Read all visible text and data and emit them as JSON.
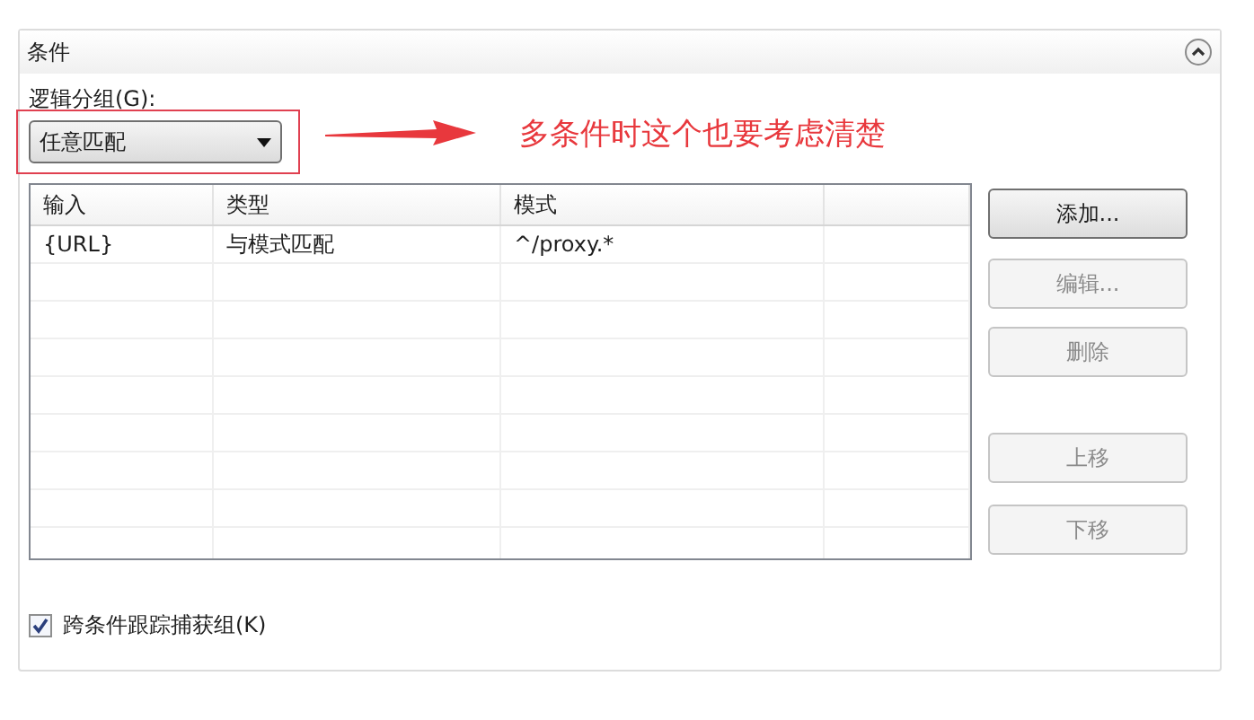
{
  "panel": {
    "title": "条件",
    "expanded": true
  },
  "logic_group": {
    "label": "逻辑分组(G):",
    "value": "任意匹配"
  },
  "annotation": {
    "note": "多条件时这个也要考虑清楚"
  },
  "table": {
    "columns": [
      "输入",
      "类型",
      "模式",
      ""
    ],
    "rows": [
      [
        "{URL}",
        "与模式匹配",
        "^/proxy.*",
        ""
      ]
    ]
  },
  "buttons": [
    {
      "label": "添加...",
      "disabled": false
    },
    {
      "label": "编辑...",
      "disabled": true
    },
    {
      "label": "删除",
      "disabled": true
    },
    {
      "label": "上移",
      "disabled": true
    },
    {
      "label": "下移",
      "disabled": true
    }
  ],
  "track_groups": {
    "label": "跨条件跟踪捕获组(K)",
    "checked": true
  }
}
